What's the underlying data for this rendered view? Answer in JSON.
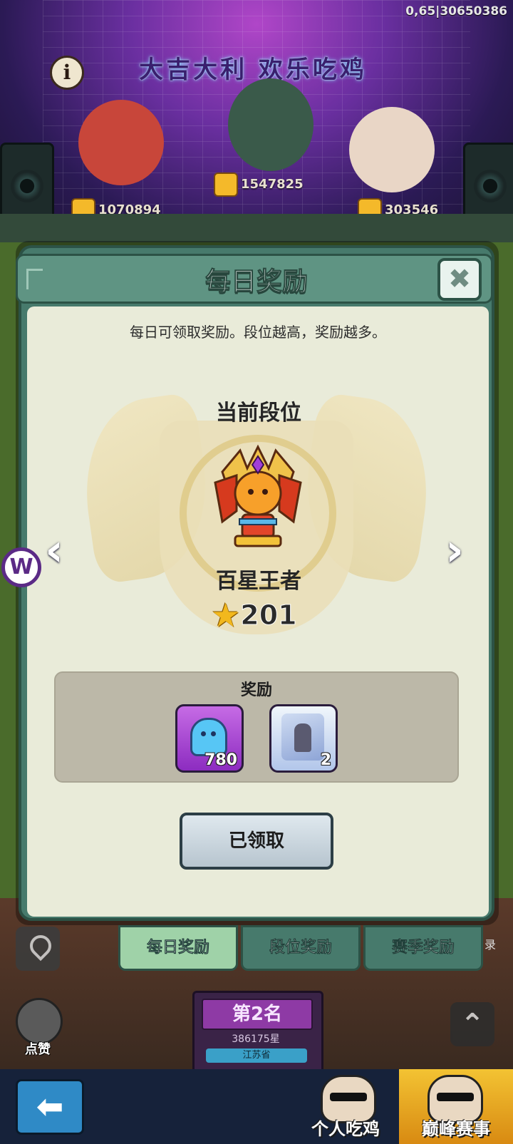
{
  "status": {
    "id_text": "0,65|30650386"
  },
  "scene": {
    "banner_text": "大吉大利 欢乐吃鸡",
    "info_icon": "i",
    "likes": [
      {
        "count": "1070894"
      },
      {
        "count": "1547825"
      },
      {
        "count": "303546"
      }
    ],
    "podium": {
      "rank": "第2名",
      "score": "386175星",
      "location": "江苏省"
    },
    "like_button_label": "点赞",
    "side_text": "录"
  },
  "dialog": {
    "title": "每日奖励",
    "close_icon": "✖",
    "description": "每日可领取奖励。段位越高，奖励越多。",
    "current_rank_label": "当前段位",
    "rank_name": "百星王者",
    "star_count": "201",
    "prev_icon": "‹",
    "next_icon": "›",
    "rewards_title": "奖励",
    "rewards": [
      {
        "icon": "ghost-currency-icon",
        "quantity": "780"
      },
      {
        "icon": "character-card-icon",
        "quantity": "2"
      }
    ],
    "claim_button": "已领取"
  },
  "tabs": [
    {
      "label": "每日奖励",
      "active": true
    },
    {
      "label": "段位奖励",
      "active": false
    },
    {
      "label": "赛季奖励",
      "active": false
    }
  ],
  "bottom_nav": {
    "back_icon": "⬅",
    "modes": [
      {
        "label": "个人吃鸡"
      },
      {
        "label": "巅峰赛事",
        "selected": true
      }
    ]
  },
  "side_badge": "W",
  "colors": {
    "dialog_frame": "#477a6c",
    "dialog_body": "#e9ebd9",
    "active_tab": "#9fd2a8",
    "reward_panel": "#bcb8a8",
    "peak_mode": "#f3c333"
  }
}
